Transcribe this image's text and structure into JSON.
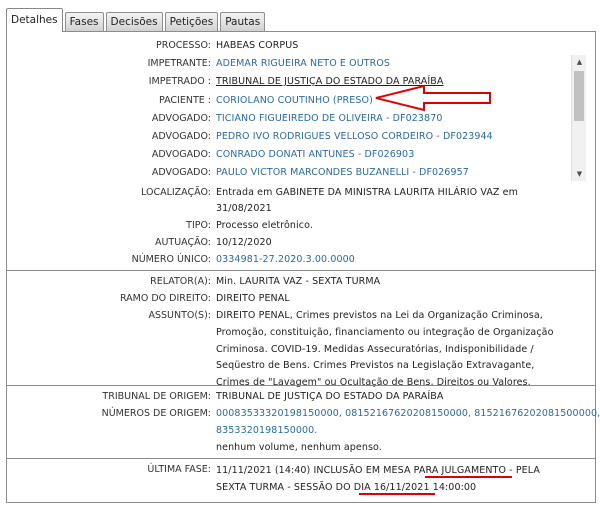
{
  "tabs": [
    {
      "label": "Detalhes",
      "active": true
    },
    {
      "label": "Fases",
      "active": false
    },
    {
      "label": "Decisões",
      "active": false
    },
    {
      "label": "Petições",
      "active": false
    },
    {
      "label": "Pautas",
      "active": false
    }
  ],
  "parties": {
    "processo_label": "PROCESSO:",
    "processo_value": "HABEAS CORPUS",
    "impetrante_label": "IMPETRANTE:",
    "impetrante_value": "ADEMAR RIGUEIRA NETO E OUTROS",
    "impetrado_label": "IMPETRADO :",
    "impetrado_value": "TRIBUNAL DE JUSTIÇA DO ESTADO DA PARAÍBA",
    "paciente_label": "PACIENTE :",
    "paciente_value": "CORIOLANO COUTINHO (PRESO)",
    "advogados": [
      {
        "label": "ADVOGADO:",
        "value": "TICIANO FIGUEIREDO DE OLIVEIRA - DF023870"
      },
      {
        "label": "ADVOGADO:",
        "value": "PEDRO IVO RODRIGUES VELLOSO CORDEIRO - DF023944"
      },
      {
        "label": "ADVOGADO:",
        "value": "CONRADO DONATI ANTUNES - DF026903"
      },
      {
        "label": "ADVOGADO:",
        "value": "PAULO VICTOR MARCONDES BUZANELLI - DF026957"
      }
    ]
  },
  "info": {
    "localizacao_label": "LOCALIZAÇÃO:",
    "localizacao_line1": "Entrada em GABINETE DA MINISTRA LAURITA HILÁRIO VAZ em",
    "localizacao_line2": "31/08/2021",
    "tipo_label": "TIPO:",
    "tipo_value": "Processo eletrônico.",
    "autuacao_label": "AUTUAÇÃO:",
    "autuacao_value": "10/12/2020",
    "numero_label": "NÚMERO ÚNICO:",
    "numero_value": "0334981-27.2020.3.00.0000"
  },
  "relator": {
    "relator_label": "RELATOR(A):",
    "relator_value": "Min. LAURITA VAZ - SEXTA TURMA",
    "ramo_label": "RAMO DO DIREITO:",
    "ramo_value": "DIREITO PENAL",
    "assuntos_label": "ASSUNTO(S):",
    "assuntos_lines": [
      "DIREITO PENAL, Crimes previstos na Lei da Organização Criminosa,",
      "Promoção, constituição, financiamento ou integração de Organização",
      "Criminosa. COVID-19. Medidas Assecuratórias, Indisponibilidade /",
      "Seqüestro de Bens. Crimes Previstos na Legislação Extravagante,",
      "Crimes de \"Lavagem\" ou Ocultação de Bens, Direitos ou Valores."
    ]
  },
  "origem": {
    "tribunal_label": "TRIBUNAL DE ORIGEM:",
    "tribunal_value": "TRIBUNAL DE JUSTIÇA DO ESTADO DA PARAÍBA",
    "numeros_label": "NÚMEROS DE ORIGEM:",
    "numeros_line1": "00083533320198150000, 08152167620208150000, 81521676202081500000,",
    "numeros_line2": "8353320198150000.",
    "volume_value": "nenhum volume, nenhum apenso."
  },
  "fase": {
    "label": "ÚLTIMA FASE:",
    "line1_a": "11/11/2021 (14:40) INCLUSÃO EM MESA PARA ",
    "line1_b": "JULGAMENTO",
    "line1_c": " - PELA",
    "line2_a": "SEXTA TURMA - SESSÃO DO ",
    "line2_b": "DIA 16/11/2021",
    "line2_c": " 14:00:00"
  },
  "colors": {
    "link": "#2a6aa3",
    "annotation": "#e00000",
    "border": "#8c8c8c"
  },
  "icons": {
    "scroll_up": "triangle-up-icon",
    "scroll_down": "triangle-down-icon",
    "annotation_arrow": "red-arrow-annotation"
  }
}
